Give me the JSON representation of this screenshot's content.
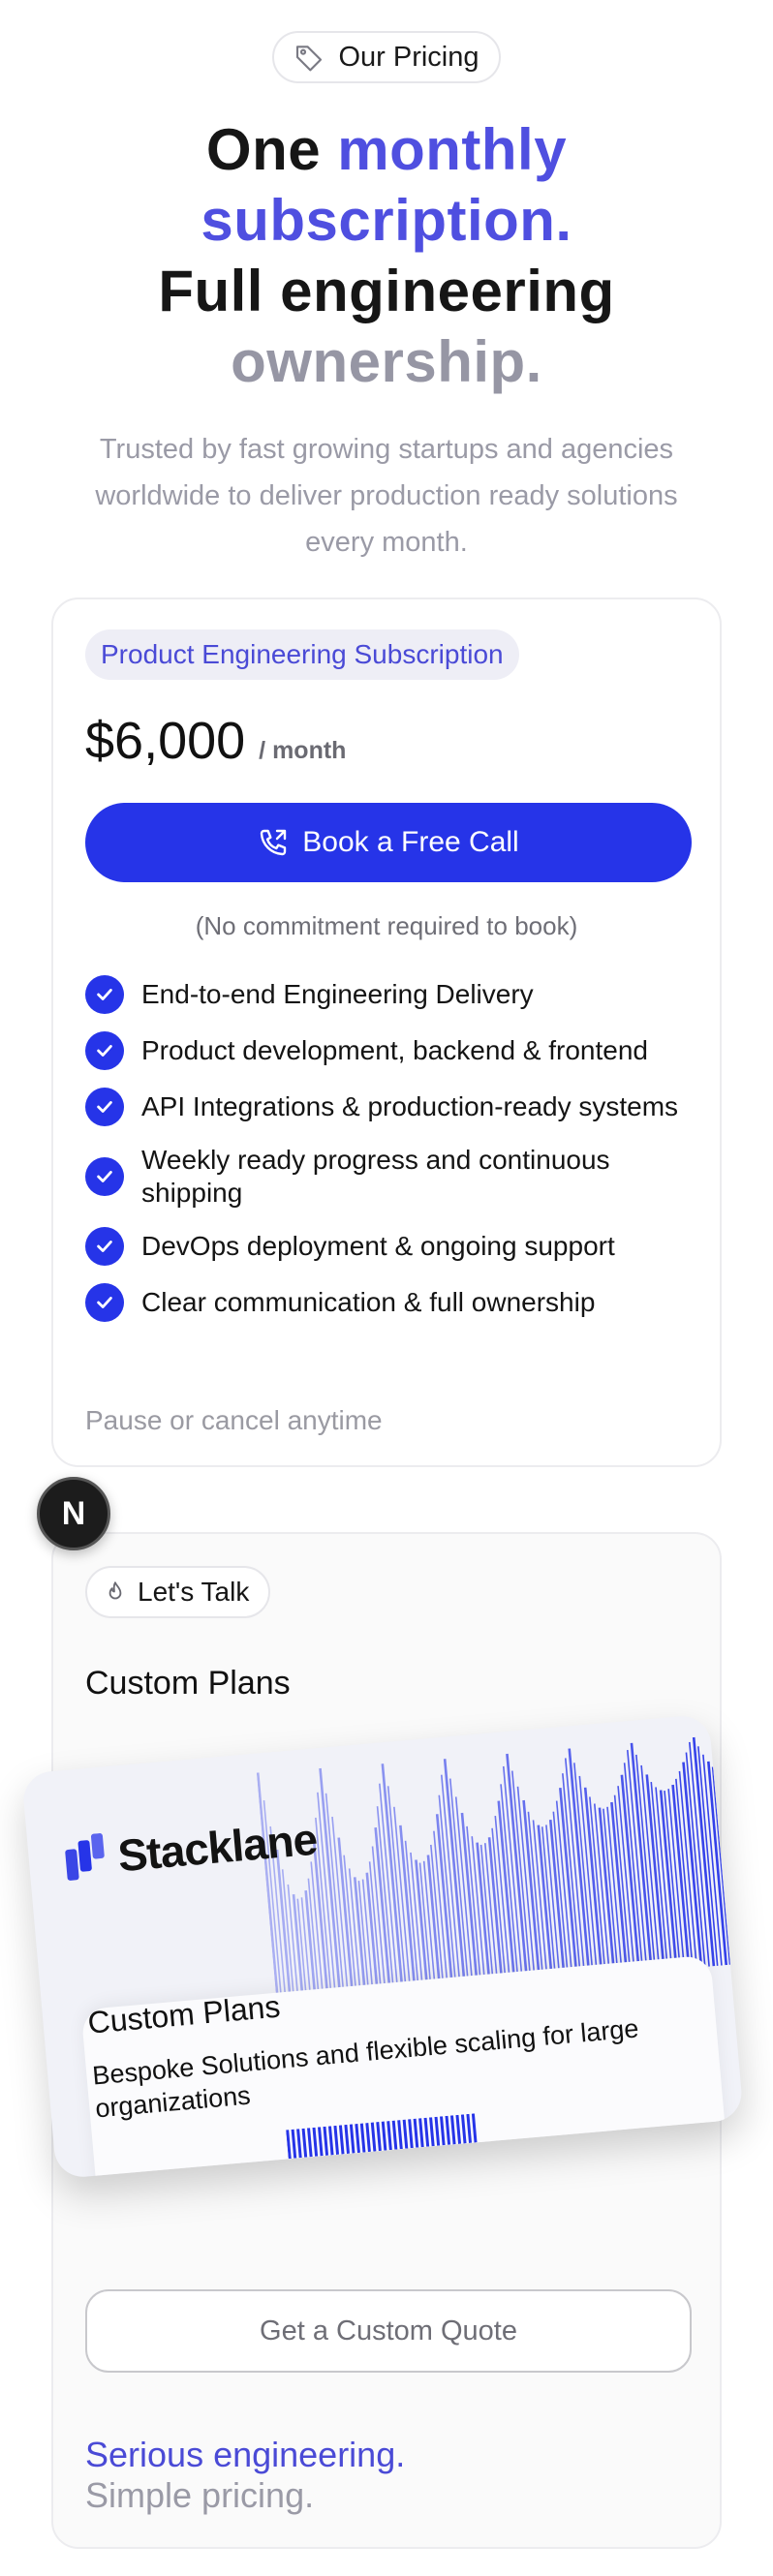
{
  "header": {
    "badge_label": "Our Pricing",
    "badge_icon": "tag-icon"
  },
  "hero": {
    "line1_a": "One ",
    "line1_b": "monthly",
    "line2": "subscription.",
    "line3": "Full engineering",
    "line4": "ownership."
  },
  "subtitle": "Trusted by fast growing startups and agencies worldwide to deliver production ready solutions every month.",
  "plan": {
    "pill": "Product Engineering Subscription",
    "price": "$6,000",
    "period": "/ month",
    "cta_label": "Book a Free Call",
    "cta_icon": "phone-icon",
    "note": "(No commitment required to book)",
    "features": [
      "End-to-end Engineering Delivery",
      "Product development, backend & frontend",
      "API Integrations & production-ready systems",
      "Weekly ready progress and continuous shipping",
      "DevOps deployment & ongoing support",
      "Clear communication & full ownership"
    ],
    "footer": "Pause or cancel anytime"
  },
  "fab": {
    "letter": "N"
  },
  "custom": {
    "pill": "Let's Talk",
    "pill_icon": "flame-icon",
    "title": "Custom Plans",
    "promo": {
      "brand": "Stacklane",
      "title": "Custom Plans",
      "desc": "Bespoke Solutions and flexible scaling for large organizations"
    },
    "quote_label": "Get a Custom Quote",
    "slogan_1": "Serious engineering.",
    "slogan_2": "Simple pricing."
  },
  "colors": {
    "accent": "#2634e8",
    "accent_text": "#4f4fe0",
    "muted": "#9a9aa6"
  }
}
